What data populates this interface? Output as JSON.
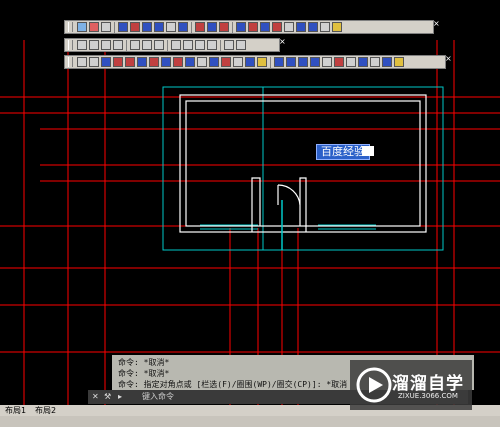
{
  "overlay_label": "百度经验",
  "command_history": [
    "命令: *取消*",
    "命令: *取消*",
    "命令: 指定对角点或 [栏选(F)/圈围(WP)/圈交(CP)]: *取消"
  ],
  "command_prompt": "键入命令",
  "tabs": [
    "布局1",
    "布局2"
  ],
  "watermark": {
    "brand": "溜溜自学",
    "url": "ZIXUE.3066.COM"
  },
  "colors": {
    "background": "#000000",
    "grid_lines": "#ff0000",
    "viewport_border": "#00c8c8",
    "walls": "#ffffff",
    "selection": "#2b60c9"
  },
  "icons": [
    "dimension-icon",
    "layer-icon",
    "draw-icon",
    "modify-icon",
    "zoom-icon",
    "pan-icon",
    "properties-icon"
  ]
}
